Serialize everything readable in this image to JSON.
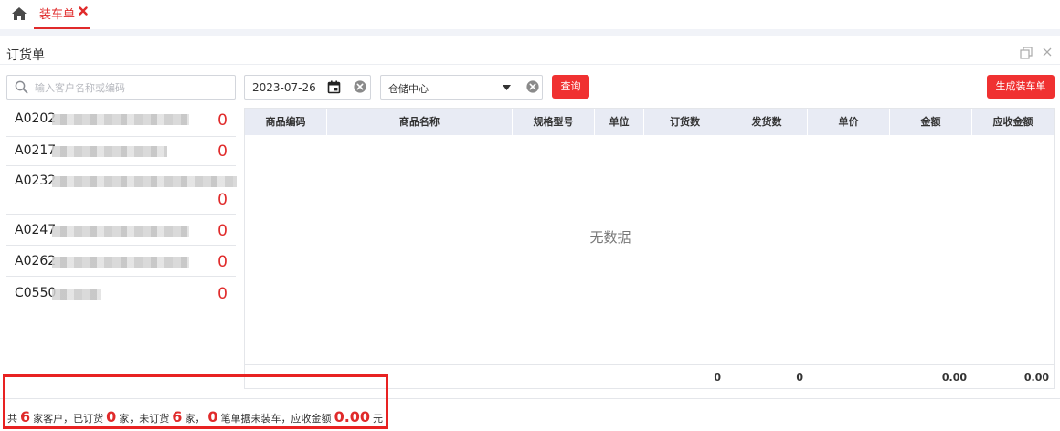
{
  "tabs": [
    {
      "label": "装车单"
    }
  ],
  "panel": {
    "title": "订货单"
  },
  "search": {
    "placeholder": "输入客户名称或编码"
  },
  "filters": {
    "date": "2023-07-26",
    "warehouse": "仓储中心"
  },
  "buttons": {
    "query": "查询",
    "generate": "生成装车单"
  },
  "customers": [
    {
      "code": "A0202",
      "count": "0"
    },
    {
      "code": "A0217",
      "count": "0"
    },
    {
      "code": "A0232",
      "count": "0"
    },
    {
      "code": "A0247",
      "count": "0"
    },
    {
      "code": "A0262",
      "count": "0"
    },
    {
      "code": "C0550",
      "count": "0"
    }
  ],
  "table": {
    "columns": [
      "商品编码",
      "商品名称",
      "规格型号",
      "单位",
      "订货数",
      "发货数",
      "单价",
      "金额",
      "应收金额"
    ],
    "empty_text": "无数据",
    "totals": {
      "order_qty": "0",
      "ship_qty": "0",
      "amount": "0.00",
      "receivable": "0.00"
    }
  },
  "summary": {
    "p1": "共",
    "total_customers": "6",
    "p2": "家客户，已订货",
    "ordered": "0",
    "p3": "家，未订货",
    "not_ordered": "6",
    "p4": "家，",
    "unloaded": "0",
    "p5": "笔单据未装车，应收金额",
    "receivable": "0.00",
    "p6": "元"
  },
  "colors": {
    "accent": "#e02a2a",
    "header_bg": "#e8ebf4",
    "highlight": "#e82222"
  }
}
